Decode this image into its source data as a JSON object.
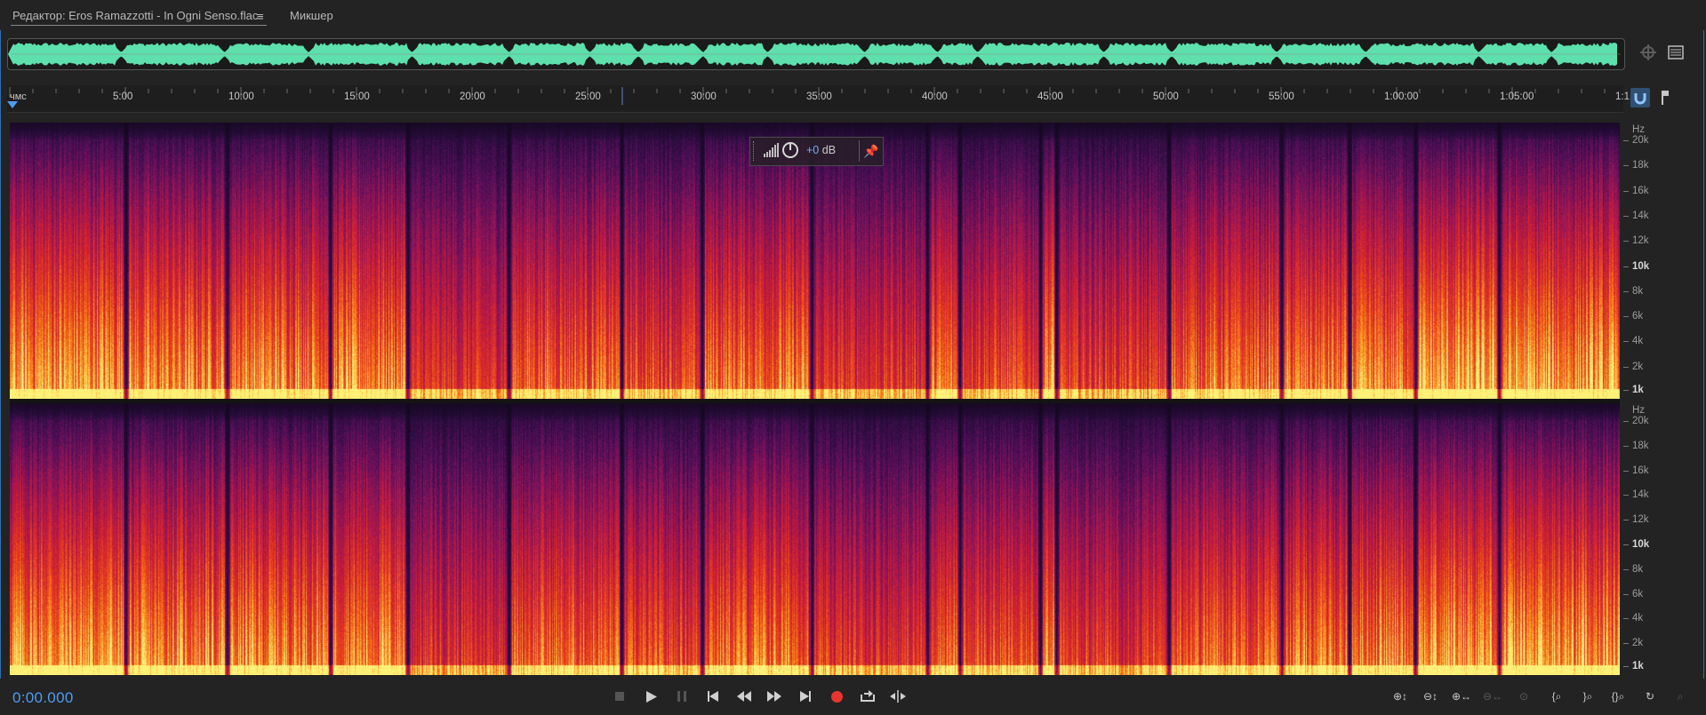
{
  "tabs": {
    "editor_label": "Редактор: Eros Ramazzotti - In Ogni Senso.flac",
    "editor_menu": "≡",
    "mixer_label": "Микшер"
  },
  "ruler": {
    "unit": "чмс",
    "ticks": [
      "5:00",
      "10:00",
      "15:00",
      "20:00",
      "25:00",
      "30:00",
      "35:00",
      "40:00",
      "45:00",
      "50:00",
      "55:00",
      "1:00:00",
      "1:05:00",
      "1:1"
    ]
  },
  "hud": {
    "gain_sign_value": "+0",
    "gain_unit": " dB"
  },
  "frequency_axis": {
    "unit": "Hz",
    "labels": [
      "20k",
      "18k",
      "16k",
      "14k",
      "12k",
      "10k",
      "8k",
      "6k",
      "4k",
      "2k",
      "1k"
    ],
    "bold_labels": [
      "10k",
      "1k"
    ]
  },
  "transport": {
    "time": "0:00.000",
    "buttons": [
      "stop",
      "play",
      "pause",
      "to-start",
      "rewind",
      "fast-forward",
      "to-end",
      "record",
      "loop",
      "skip-selection"
    ]
  },
  "icons": {
    "overview_zoom": "zoom-overview-icon",
    "overview_menu": "panel-menu-icon",
    "snap": "magnet-icon",
    "marker": "marker-flag-icon"
  },
  "colors": {
    "accent": "#4f9cf0",
    "waveform": "#5de0ac",
    "record": "#e8352f"
  }
}
